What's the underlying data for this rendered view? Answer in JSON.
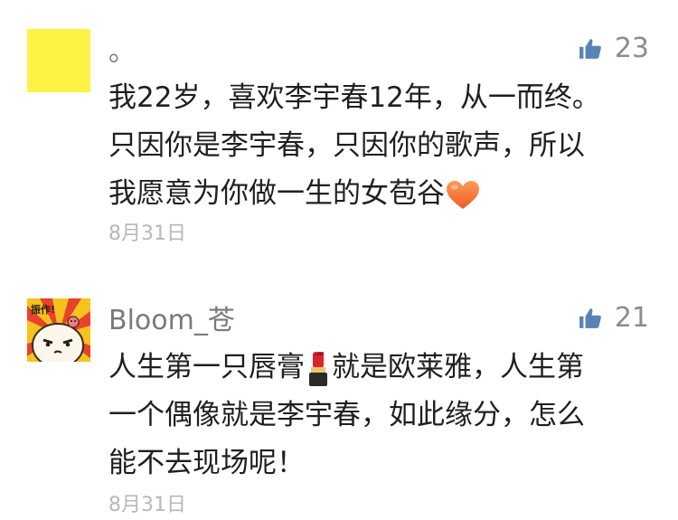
{
  "comments": [
    {
      "nickname": "。",
      "likes": "23",
      "lines": [
        "我22岁，喜欢李宇春12年，从一而终。",
        "只因你是李宇春，只因你的歌声，所以",
        "我愿意为你做一生的女苞谷"
      ],
      "date": "8月31日",
      "avatar_color": "#fef245",
      "trailing_emoji": "orange-heart"
    },
    {
      "nickname": "Bloom_苍",
      "likes": "21",
      "line1_a": "人生第一只唇膏",
      "line1_b": "就是欧莱雅，人生第",
      "lines": [
        "一个偶像就是李宇春，如此缘分，怎么",
        "能不去现场呢！"
      ],
      "date": "8月31日",
      "avatar_sticker_text": "振作!",
      "inline_emoji": "lipstick"
    }
  ],
  "colors": {
    "thumb_icon": "#5a83b5",
    "heart": "#f47b3c",
    "lipstick": "#d9242f"
  }
}
